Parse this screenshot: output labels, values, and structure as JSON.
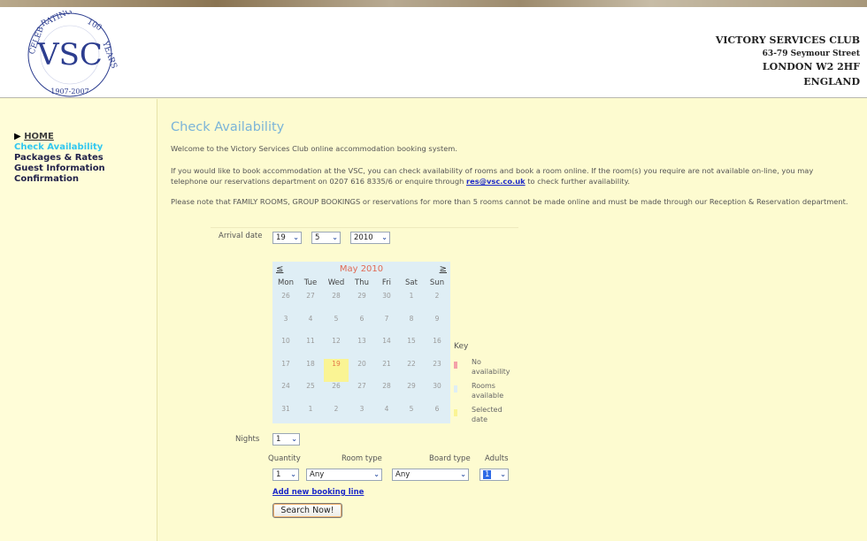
{
  "header": {
    "logo": {
      "ring_text": "CELEBRATING 100 YEARS",
      "monogram": "VSC",
      "years": "1907-2007"
    },
    "address": {
      "club_name": "VICTORY SERVICES CLUB",
      "street": "63-79 Seymour Street",
      "city": "LONDON W2 2HF",
      "country": "ENGLAND"
    }
  },
  "nav": {
    "home": "HOME",
    "steps": [
      "Check Availability",
      "Packages & Rates",
      "Guest Information",
      "Confirmation"
    ],
    "active_index": 0
  },
  "main": {
    "title": "Check Availability",
    "intro": "Welcome to the Victory Services Club online accommodation booking system.",
    "para2_a": "If you would like to book accommodation at the VSC, you can check availability of rooms and book a room online. If the room(s) you require are not available on-line, you may telephone our reservations department on 0207 616 8335/6 or enquire through ",
    "email": "res@vsc.co.uk",
    "para2_b": " to check further availability.",
    "para3": "Please note that FAMILY ROOMS, GROUP BOOKINGS or reservations for more than 5 rooms cannot be made online and must be made through our Reception & Reservation department.",
    "arrival_label": "Arrival date",
    "arrival_day": "19",
    "arrival_month": "5",
    "arrival_year": "2010",
    "nights_label": "Nights",
    "nights": "1",
    "col_quantity": "Quantity",
    "col_room_type": "Room type",
    "col_board_type": "Board type",
    "col_adults": "Adults",
    "quantity": "1",
    "room_type": "Any",
    "board_type": "Any",
    "adults": "1",
    "add_line": "Add new booking line",
    "search_button": "Search Now!"
  },
  "calendar": {
    "prev": "≤",
    "next": "≥",
    "month_label": "May 2010",
    "weekdays": [
      "Mon",
      "Tue",
      "Wed",
      "Thu",
      "Fri",
      "Sat",
      "Sun"
    ],
    "weeks": [
      [
        "26",
        "27",
        "28",
        "29",
        "30",
        "1",
        "2"
      ],
      [
        "3",
        "4",
        "5",
        "6",
        "7",
        "8",
        "9"
      ],
      [
        "10",
        "11",
        "12",
        "13",
        "14",
        "15",
        "16"
      ],
      [
        "17",
        "18",
        "19",
        "20",
        "21",
        "22",
        "23"
      ],
      [
        "24",
        "25",
        "26",
        "27",
        "28",
        "29",
        "30"
      ],
      [
        "31",
        "1",
        "2",
        "3",
        "4",
        "5",
        "6"
      ]
    ],
    "selected_day": "19"
  },
  "key": {
    "title": "Key",
    "items": [
      {
        "label": "No availability",
        "color": "#f4a0a8"
      },
      {
        "label": "Rooms available",
        "color": "#dfeef5"
      },
      {
        "label": "Selected date",
        "color": "#faf494"
      }
    ]
  },
  "colors": {
    "background": "#fdfbd0",
    "title": "#7bb4d8",
    "link": "#1c28c8",
    "active_nav": "#31c7f0",
    "calendar_bg": "#dfeef5",
    "selected_date": "#faf494"
  }
}
